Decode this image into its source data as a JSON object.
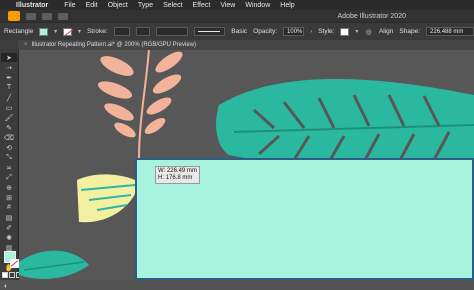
{
  "menubar": {
    "apple_glyph": "",
    "app": "Illustrator",
    "menus": [
      "File",
      "Edit",
      "Object",
      "Type",
      "Select",
      "Effect",
      "View",
      "Window",
      "Help"
    ]
  },
  "appbar": {
    "title": "Adobe Illustrator 2020"
  },
  "control": {
    "selection_label": "Rectangle",
    "stroke_label": "Stroke:",
    "brush_label": "Basic",
    "opacity_label": "Opacity:",
    "opacity_value": "100%",
    "style_label": "Style:",
    "align_label": "Align",
    "shape_label": "Shape:",
    "width_value": "226.488 mm"
  },
  "document_tab": {
    "close_glyph": "×",
    "label": "Illustrator Repeating Pattern.ai* @ 200% (RGB/GPU Preview)"
  },
  "tooltip": {
    "w": "W: 226.49 mm",
    "h": "H: 176.8 mm"
  },
  "colors": {
    "fill": "#a8f3dd",
    "canvas": "#575757",
    "peach_leaf": "#f3b29a",
    "teal_leaf": "#2bb8a0",
    "yellow_leaf": "#f4f0a2",
    "stroke_red": "#e63a3a",
    "selection_border": "#2b5d86"
  },
  "icons": {
    "selection": "selection-arrow-icon",
    "direct_selection": "direct-selection-icon",
    "pen": "pen-icon",
    "type": "type-icon",
    "line": "line-icon",
    "rectangle": "rectangle-icon",
    "paintbrush": "paintbrush-icon",
    "pencil": "pencil-icon",
    "eraser": "eraser-icon",
    "rotate": "rotate-icon",
    "scale": "scale-icon",
    "width": "width-icon",
    "free_transform": "free-transform-icon",
    "shape_builder": "shape-builder-icon",
    "perspective": "perspective-grid-icon",
    "mesh": "mesh-icon",
    "gradient": "gradient-icon",
    "eyedropper": "eyedropper-icon",
    "blend": "blend-icon",
    "symbol": "symbol-sprayer-icon",
    "graph": "graph-icon",
    "artboard": "artboard-icon",
    "slice": "slice-icon",
    "hand": "hand-icon",
    "zoom": "zoom-icon"
  }
}
